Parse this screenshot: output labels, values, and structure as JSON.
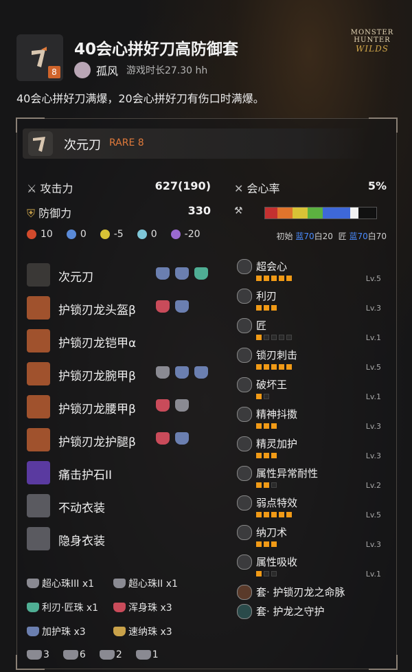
{
  "logo": {
    "line1": "MONSTER HUNTER",
    "line2": "WILDS"
  },
  "header": {
    "rarity": "8",
    "title": "40会心拼好刀高防御套",
    "author": "孤风",
    "playtime": "游戏时长27.30 hh",
    "description": "40会心拼好刀满爆，20会心拼好刀有伤口时满爆。"
  },
  "weapon": {
    "name": "次元刀",
    "rare": "RARE 8"
  },
  "stats": {
    "attack_label": "攻击力",
    "attack_value": "627(190)",
    "defense_label": "防御力",
    "defense_value": "330",
    "affinity_label": "会心率",
    "affinity_value": "5%",
    "elements": [
      "10",
      "0",
      "-5",
      "0",
      "-20"
    ],
    "sharpness_initial_label": "初始",
    "sharpness_initial_blue": "蓝70",
    "sharpness_initial_white": "白20",
    "sharpness_handicraft_label": "匠",
    "sharpness_handicraft_blue": "蓝70",
    "sharpness_handicraft_white": "白70"
  },
  "equipment": [
    {
      "name": "次元刀",
      "slots": [
        "#6b7fb0",
        "#6b7fb0",
        "#4fae94"
      ]
    },
    {
      "name": "护锁刃龙头盔β",
      "slots": [
        "#c94b5a",
        "#6b7fb0"
      ]
    },
    {
      "name": "护锁刃龙铠甲α",
      "slots": []
    },
    {
      "name": "护锁刃龙腕甲β",
      "slots": [
        "#8a8a92",
        "#6b7fb0",
        "#6b7fb0"
      ]
    },
    {
      "name": "护锁刃龙腰甲β",
      "slots": [
        "#c94b5a",
        "#8a8a92"
      ]
    },
    {
      "name": "护锁刃龙护腿β",
      "slots": [
        "#c94b5a",
        "#6b7fb0"
      ]
    },
    {
      "name": "痛击护石II",
      "slots": []
    },
    {
      "name": "不动衣装",
      "slots": []
    },
    {
      "name": "隐身衣装",
      "slots": []
    }
  ],
  "skills": [
    {
      "name": "超会心",
      "on": 5,
      "max": 5,
      "level": "Lv.5"
    },
    {
      "name": "利刃",
      "on": 3,
      "max": 3,
      "level": "Lv.3"
    },
    {
      "name": "匠",
      "on": 1,
      "max": 5,
      "level": "Lv.1"
    },
    {
      "name": "锁刃刺击",
      "on": 5,
      "max": 5,
      "level": "Lv.5"
    },
    {
      "name": "破坏王",
      "on": 1,
      "max": 2,
      "level": "Lv.1"
    },
    {
      "name": "精神抖擞",
      "on": 3,
      "max": 3,
      "level": "Lv.3"
    },
    {
      "name": "精灵加护",
      "on": 3,
      "max": 3,
      "level": "Lv.3"
    },
    {
      "name": "属性异常耐性",
      "on": 2,
      "max": 3,
      "level": "Lv.2"
    },
    {
      "name": "弱点特效",
      "on": 5,
      "max": 5,
      "level": "Lv.5"
    },
    {
      "name": "纳刀术",
      "on": 3,
      "max": 3,
      "level": "Lv.3"
    },
    {
      "name": "属性吸收",
      "on": 1,
      "max": 3,
      "level": "Lv.1"
    }
  ],
  "set_bonuses": [
    "套· 护锁刃龙之命脉",
    "套· 护龙之守护"
  ],
  "decorations": [
    {
      "label": "超心珠III x1",
      "color": "#8a8a92"
    },
    {
      "label": "超心珠II x1",
      "color": "#8a8a92"
    },
    {
      "label": "利刃·匠珠 x1",
      "color": "#4fae94"
    },
    {
      "label": "浑身珠 x3",
      "color": "#c94b5a"
    },
    {
      "label": "加护珠 x3",
      "color": "#6b7fb0"
    },
    {
      "label": "速纳珠 x3",
      "color": "#c9a24a"
    }
  ],
  "slot_counts": [
    "3",
    "6",
    "2",
    "1"
  ]
}
